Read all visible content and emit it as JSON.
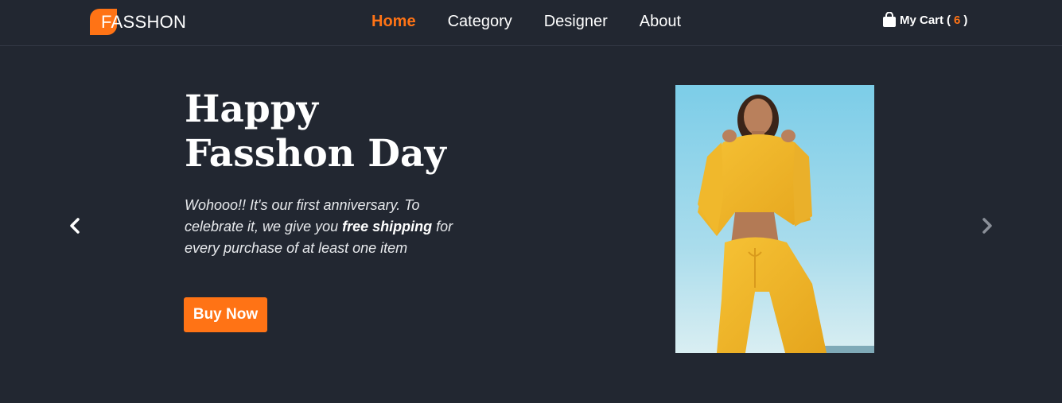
{
  "brand": {
    "name": "FASSHON",
    "accent_color": "#ff7315",
    "background_color": "#222731"
  },
  "nav": {
    "links": [
      {
        "label": "Home",
        "active": true
      },
      {
        "label": "Category",
        "active": false
      },
      {
        "label": "Designer",
        "active": false
      },
      {
        "label": "About",
        "active": false
      }
    ]
  },
  "cart": {
    "label": "My Cart",
    "count": "6",
    "icon": "shopping-bag-icon"
  },
  "hero": {
    "title_line1": "Happy",
    "title_line2": "Fasshon Day",
    "desc_part1": "Wohooo!! It's our first anniversary. To celebrate it, we give you ",
    "desc_bold": "free shipping",
    "desc_part2": " for every purchase of at least one item",
    "cta_label": "Buy Now",
    "image_icon": "model-in-yellow-tracksuit-photo"
  },
  "carousel": {
    "prev_icon": "chevron-left-icon",
    "next_icon": "chevron-right-icon"
  }
}
